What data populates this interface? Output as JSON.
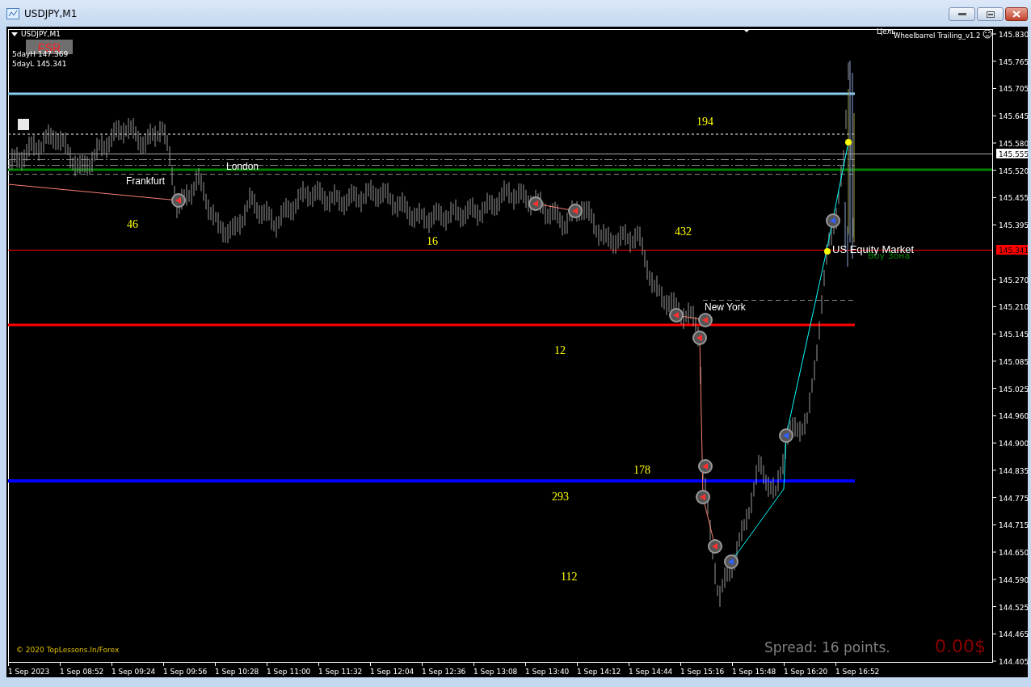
{
  "window": {
    "title": "USDJPY,M1"
  },
  "chart": {
    "symbol": "USDJPY,M1",
    "indicator_box": "FSR",
    "info_lines": [
      "5dayH 147.369",
      "5dayL 145.341"
    ],
    "target_label": "Цель",
    "ea_name": "Wheelbarrel Trailing_v1.2",
    "sessions": [
      {
        "name": "London"
      },
      {
        "name": "Frankfurt"
      },
      {
        "name": "New York"
      },
      {
        "name": "US Equity Market"
      }
    ],
    "zone_label": "Buy Зона",
    "range_counts": [
      "194",
      "46",
      "16",
      "432",
      "12",
      "178",
      "293",
      "112"
    ],
    "copyright": "© 2020 TopLessons.In/Forex",
    "spread": "Spread: 16 points.",
    "profit": "0.00$",
    "price_tags": [
      {
        "text": "145.555",
        "kind": "bid"
      },
      {
        "text": "145.341",
        "kind": "level"
      }
    ]
  },
  "price_axis": {
    "ticks": [
      "145.830",
      "145.765",
      "145.705",
      "145.645",
      "145.580",
      "145.520",
      "145.455",
      "145.395",
      "145.270",
      "145.210",
      "145.145",
      "145.085",
      "145.025",
      "144.960",
      "144.900",
      "144.835",
      "144.775",
      "144.715",
      "144.650",
      "144.590",
      "144.525",
      "144.465",
      "144.405"
    ]
  },
  "time_axis": {
    "ticks": [
      "1 Sep 2023",
      "1 Sep 08:52",
      "1 Sep 09:24",
      "1 Sep 09:56",
      "1 Sep 10:28",
      "1 Sep 11:00",
      "1 Sep 11:32",
      "1 Sep 12:04",
      "1 Sep 12:36",
      "1 Sep 13:08",
      "1 Sep 13:40",
      "1 Sep 14:12",
      "1 Sep 14:44",
      "1 Sep 15:16",
      "1 Sep 15:48",
      "1 Sep 16:20",
      "1 Sep 16:52"
    ]
  }
}
